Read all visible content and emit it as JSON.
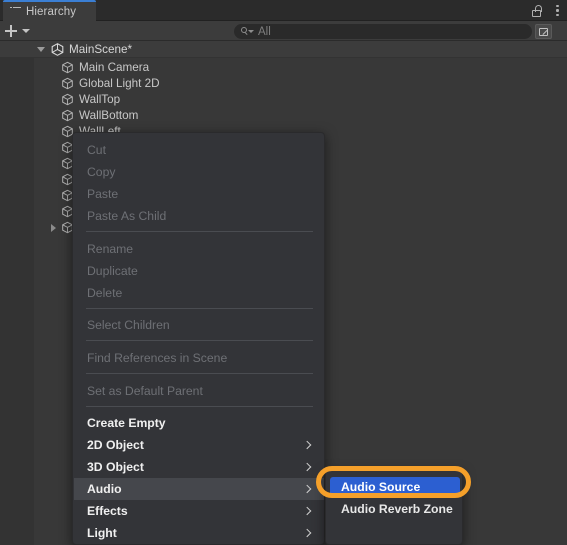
{
  "window": {
    "tab_label": "Hierarchy",
    "tab_icon": "hierarchy-icon",
    "lock_icon": "lock-open-icon",
    "menu_icon": "kebab-menu-icon"
  },
  "toolbar": {
    "add_label": "+",
    "add_dropdown_icon": "caret-down-icon",
    "search_placeholder": "All",
    "search_icon": "search-icon",
    "popout_icon": "popout-window-icon",
    "row_menu_icon": "kebab-menu-icon"
  },
  "hierarchy": {
    "scene": {
      "name": "MainScene*",
      "expanded": true,
      "icon": "unity-scene-icon"
    },
    "items": [
      {
        "name": "Main Camera",
        "icon": "gameobject-cube-icon",
        "expandable": false
      },
      {
        "name": "Global Light 2D",
        "icon": "gameobject-cube-icon",
        "expandable": false
      },
      {
        "name": "WallTop",
        "icon": "gameobject-cube-icon",
        "expandable": false
      },
      {
        "name": "WallBottom",
        "icon": "gameobject-cube-icon",
        "expandable": false
      },
      {
        "name": "WallLeft",
        "icon": "gameobject-cube-icon",
        "expandable": false
      },
      {
        "name": "",
        "icon": "gameobject-cube-icon",
        "expandable": false
      },
      {
        "name": "",
        "icon": "gameobject-cube-icon",
        "expandable": false
      },
      {
        "name": "",
        "icon": "gameobject-cube-icon",
        "expandable": false
      },
      {
        "name": "",
        "icon": "gameobject-cube-icon",
        "expandable": false
      },
      {
        "name": "",
        "icon": "gameobject-cube-icon",
        "expandable": false
      },
      {
        "name": "",
        "icon": "gameobject-cube-icon",
        "expandable": true
      }
    ]
  },
  "context_menu": {
    "items": [
      {
        "label": "Cut",
        "state": "disabled",
        "submenu": false
      },
      {
        "label": "Copy",
        "state": "disabled",
        "submenu": false
      },
      {
        "label": "Paste",
        "state": "disabled",
        "submenu": false
      },
      {
        "label": "Paste As Child",
        "state": "disabled",
        "submenu": false
      },
      {
        "label": "Rename",
        "state": "disabled",
        "submenu": false
      },
      {
        "label": "Duplicate",
        "state": "disabled",
        "submenu": false
      },
      {
        "label": "Delete",
        "state": "disabled",
        "submenu": false
      },
      {
        "label": "Select Children",
        "state": "disabled",
        "submenu": false
      },
      {
        "label": "Find References in Scene",
        "state": "disabled",
        "submenu": false
      },
      {
        "label": "Set as Default Parent",
        "state": "disabled",
        "submenu": false
      },
      {
        "label": "Create Empty",
        "state": "enabled",
        "submenu": false
      },
      {
        "label": "2D Object",
        "state": "enabled",
        "submenu": true
      },
      {
        "label": "3D Object",
        "state": "enabled",
        "submenu": true
      },
      {
        "label": "Audio",
        "state": "highlighted",
        "submenu": true
      },
      {
        "label": "Effects",
        "state": "enabled",
        "submenu": true
      },
      {
        "label": "Light",
        "state": "enabled",
        "submenu": true
      }
    ]
  },
  "submenu": {
    "parent": "Audio",
    "items": [
      {
        "label": "Audio Source",
        "selected": true
      },
      {
        "label": "Audio Reverb Zone",
        "selected": false
      }
    ]
  },
  "annotation": {
    "shape": "ellipse",
    "color": "#f5a02a",
    "targets": "Audio Source"
  },
  "colors": {
    "panel_bg": "#383838",
    "toolbar_bg": "#3c3c3c",
    "menu_bg": "#333438",
    "accent_selection": "#2c5fd1",
    "tab_active_border": "#3b7fd4",
    "annotation": "#f5a02a",
    "text_enabled": "#f0f0f0",
    "text_disabled": "#6e7075"
  }
}
